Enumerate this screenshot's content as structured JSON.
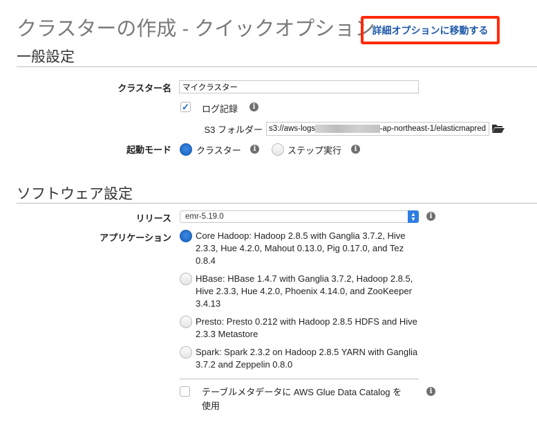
{
  "page": {
    "title": "クラスターの作成 - クイックオプション",
    "advanced_link": "詳細オプションに移動する"
  },
  "general": {
    "heading": "一般設定",
    "cluster_name_label": "クラスター名",
    "cluster_name_value": "マイクラスター",
    "logging_label": "ログ記録",
    "logging_checked": true,
    "s3_folder_label": "S3 フォルダー",
    "s3_folder_prefix": "s3://aws-logs",
    "s3_folder_suffix": "-ap-northeast-1/elasticmapred",
    "launch_mode_label": "起動モード",
    "launch_modes": [
      {
        "label": "クラスター",
        "selected": true
      },
      {
        "label": "ステップ実行",
        "selected": false
      }
    ]
  },
  "software": {
    "heading": "ソフトウェア設定",
    "release_label": "リリース",
    "release_value": "emr-5.19.0",
    "applications_label": "アプリケーション",
    "applications": [
      {
        "label": "Core Hadoop: Hadoop 2.8.5 with Ganglia 3.7.2, Hive 2.3.3, Hue 4.2.0, Mahout 0.13.0, Pig 0.17.0, and Tez 0.8.4",
        "selected": true
      },
      {
        "label": "HBase: HBase 1.4.7 with Ganglia 3.7.2, Hadoop 2.8.5, Hive 2.3.3, Hue 4.2.0, Phoenix 4.14.0, and ZooKeeper 3.4.13",
        "selected": false
      },
      {
        "label": "Presto: Presto 0.212 with Hadoop 2.8.5 HDFS and Hive 2.3.3 Metastore",
        "selected": false
      },
      {
        "label": "Spark: Spark 2.3.2 on Hadoop 2.8.5 YARN with Ganglia 3.7.2 and Zeppelin 0.8.0",
        "selected": false
      }
    ],
    "glue_label": "テーブルメタデータに AWS Glue Data Catalog を使用",
    "glue_checked": false
  },
  "icons": {
    "info": "i",
    "check": "✓"
  }
}
